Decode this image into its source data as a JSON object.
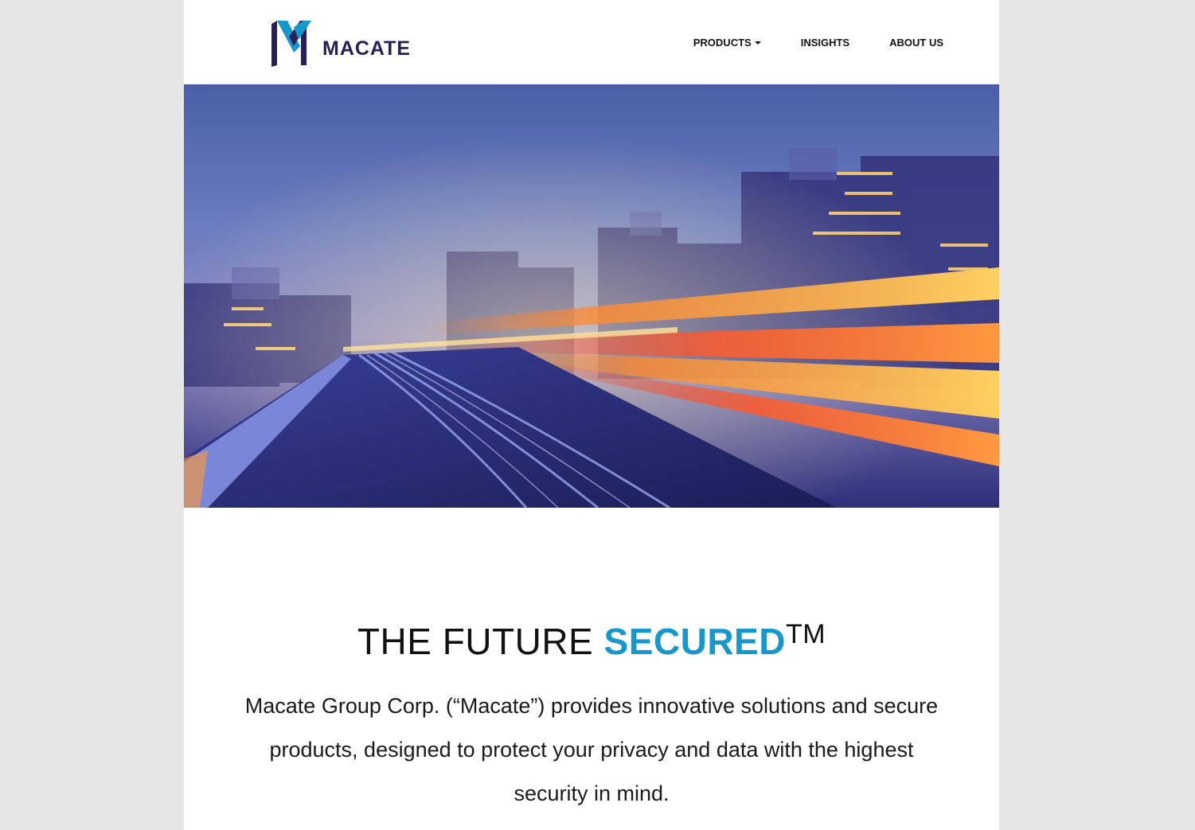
{
  "brand": {
    "name": "MACATE",
    "colors": {
      "primary": "#2a1f56",
      "accent": "#1698cc"
    }
  },
  "nav": {
    "products": "PRODUCTS",
    "insights": "INSIGHTS",
    "about": "ABOUT US"
  },
  "hero": {
    "image": "motion-blur-city-rail-at-dusk"
  },
  "tagline": {
    "prefix": "THE FUTURE ",
    "highlight": "SECURED",
    "mark": "TM"
  },
  "intro": {
    "text": "Macate Group Corp. (“Macate”) provides innovative solutions and secure products, designed to protect your privacy and data with the highest security in mind."
  }
}
